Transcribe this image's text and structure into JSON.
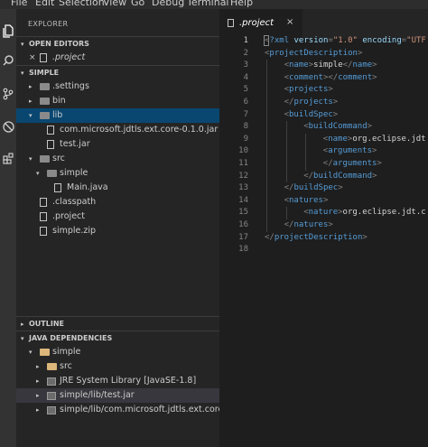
{
  "menu": [
    "File",
    "Edit",
    "Selection",
    "View",
    "Go",
    "Debug",
    "Terminal",
    "Help"
  ],
  "activity": [
    "files-icon",
    "search-icon",
    "source-control-icon",
    "debug-icon",
    "extensions-icon"
  ],
  "explorer": {
    "title": "EXPLORER",
    "open_editors": {
      "label": "OPEN EDITORS",
      "items": [
        {
          "close": "×",
          "name": ".project"
        }
      ]
    },
    "project": {
      "label": "SIMPLE",
      "tree": [
        {
          "name": ".settings",
          "kind": "folder",
          "expanded": false,
          "depth": 1
        },
        {
          "name": "bin",
          "kind": "folder",
          "expanded": false,
          "depth": 1
        },
        {
          "name": "lib",
          "kind": "folder",
          "expanded": true,
          "depth": 1,
          "selected": true
        },
        {
          "name": "com.microsoft.jdtls.ext.core-0.1.0.jar",
          "kind": "file",
          "depth": 2
        },
        {
          "name": "test.jar",
          "kind": "file",
          "depth": 2
        },
        {
          "name": "src",
          "kind": "folder",
          "expanded": true,
          "depth": 1
        },
        {
          "name": "simple",
          "kind": "folder",
          "expanded": true,
          "depth": 2
        },
        {
          "name": "Main.java",
          "kind": "file",
          "depth": 3
        },
        {
          "name": ".classpath",
          "kind": "file",
          "depth": 1
        },
        {
          "name": ".project",
          "kind": "file",
          "depth": 1
        },
        {
          "name": "simple.zip",
          "kind": "file",
          "depth": 1
        }
      ]
    },
    "outline": {
      "label": "OUTLINE"
    },
    "java_dependencies": {
      "label": "JAVA DEPENDENCIES",
      "tree": [
        {
          "name": "simple",
          "kind": "project",
          "expanded": true,
          "depth": 1
        },
        {
          "name": "src",
          "kind": "package",
          "expanded": false,
          "depth": 2
        },
        {
          "name": "JRE System Library [JavaSE-1.8]",
          "kind": "library",
          "expanded": false,
          "depth": 2
        },
        {
          "name": "simple/lib/test.jar",
          "kind": "jar",
          "expanded": false,
          "depth": 2,
          "hover": true
        },
        {
          "name": "simple/lib/com.microsoft.jdtls.ext.core-...",
          "kind": "jar",
          "expanded": false,
          "depth": 2
        }
      ]
    }
  },
  "editor": {
    "tab": {
      "label": ".project",
      "close": "×"
    },
    "current_line": 1,
    "lines": [
      {
        "n": "1",
        "indent": 0,
        "parts": [
          [
            "t",
            "<"
          ],
          [
            "k",
            "?xml "
          ],
          [
            "a",
            "version"
          ],
          [
            "t",
            "="
          ],
          [
            "s",
            "\"1.0\""
          ],
          [
            "t",
            " "
          ],
          [
            "a",
            "encoding"
          ],
          [
            "t",
            "="
          ],
          [
            "s",
            "\"UTF"
          ]
        ]
      },
      {
        "n": "2",
        "indent": 0,
        "parts": [
          [
            "t",
            "<"
          ],
          [
            "k",
            "projectDescription"
          ],
          [
            "t",
            ">"
          ]
        ]
      },
      {
        "n": "3",
        "indent": 1,
        "parts": [
          [
            "t",
            "<"
          ],
          [
            "k",
            "name"
          ],
          [
            "t",
            ">"
          ],
          [
            "x",
            "simple"
          ],
          [
            "t",
            "</"
          ],
          [
            "k",
            "name"
          ],
          [
            "t",
            ">"
          ]
        ]
      },
      {
        "n": "4",
        "indent": 1,
        "parts": [
          [
            "t",
            "<"
          ],
          [
            "k",
            "comment"
          ],
          [
            "t",
            "></"
          ],
          [
            "k",
            "comment"
          ],
          [
            "t",
            ">"
          ]
        ]
      },
      {
        "n": "5",
        "indent": 1,
        "parts": [
          [
            "t",
            "<"
          ],
          [
            "k",
            "projects"
          ],
          [
            "t",
            ">"
          ]
        ]
      },
      {
        "n": "6",
        "indent": 1,
        "parts": [
          [
            "t",
            "</"
          ],
          [
            "k",
            "projects"
          ],
          [
            "t",
            ">"
          ]
        ]
      },
      {
        "n": "7",
        "indent": 1,
        "parts": [
          [
            "t",
            "<"
          ],
          [
            "k",
            "buildSpec"
          ],
          [
            "t",
            ">"
          ]
        ]
      },
      {
        "n": "8",
        "indent": 2,
        "parts": [
          [
            "t",
            "<"
          ],
          [
            "k",
            "buildCommand"
          ],
          [
            "t",
            ">"
          ]
        ]
      },
      {
        "n": "9",
        "indent": 3,
        "parts": [
          [
            "t",
            "<"
          ],
          [
            "k",
            "name"
          ],
          [
            "t",
            ">"
          ],
          [
            "x",
            "org.eclipse.jdt"
          ]
        ]
      },
      {
        "n": "10",
        "indent": 3,
        "parts": [
          [
            "t",
            "<"
          ],
          [
            "k",
            "arguments"
          ],
          [
            "t",
            ">"
          ]
        ]
      },
      {
        "n": "11",
        "indent": 3,
        "parts": [
          [
            "t",
            "</"
          ],
          [
            "k",
            "arguments"
          ],
          [
            "t",
            ">"
          ]
        ]
      },
      {
        "n": "12",
        "indent": 2,
        "parts": [
          [
            "t",
            "</"
          ],
          [
            "k",
            "buildCommand"
          ],
          [
            "t",
            ">"
          ]
        ]
      },
      {
        "n": "13",
        "indent": 1,
        "parts": [
          [
            "t",
            "</"
          ],
          [
            "k",
            "buildSpec"
          ],
          [
            "t",
            ">"
          ]
        ]
      },
      {
        "n": "14",
        "indent": 1,
        "parts": [
          [
            "t",
            "<"
          ],
          [
            "k",
            "natures"
          ],
          [
            "t",
            ">"
          ]
        ]
      },
      {
        "n": "15",
        "indent": 2,
        "parts": [
          [
            "t",
            "<"
          ],
          [
            "k",
            "nature"
          ],
          [
            "t",
            ">"
          ],
          [
            "x",
            "org.eclipse.jdt.c"
          ]
        ]
      },
      {
        "n": "16",
        "indent": 1,
        "parts": [
          [
            "t",
            "</"
          ],
          [
            "k",
            "natures"
          ],
          [
            "t",
            ">"
          ]
        ]
      },
      {
        "n": "17",
        "indent": 0,
        "parts": [
          [
            "t",
            "</"
          ],
          [
            "k",
            "projectDescription"
          ],
          [
            "t",
            ">"
          ]
        ]
      },
      {
        "n": "18",
        "indent": 0,
        "parts": []
      }
    ]
  },
  "colors": {
    "tag": "#808080",
    "tag_name": "#569cd6",
    "attr": "#9cdcfe",
    "string": "#ce9178",
    "text": "#d4d4d4",
    "selection": "#094771"
  }
}
